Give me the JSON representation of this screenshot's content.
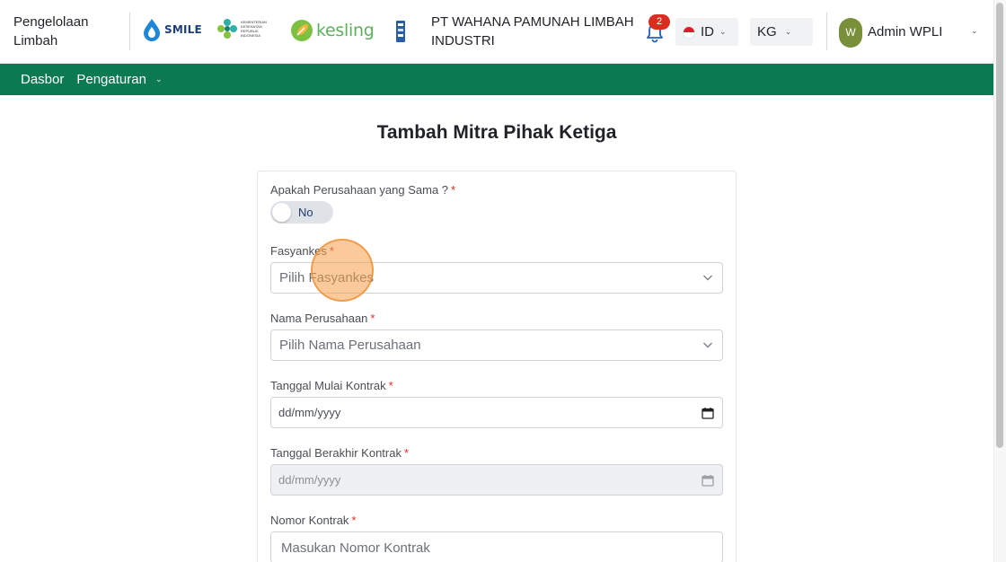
{
  "header": {
    "app_title": "Pengelolaan Limbah",
    "logos": [
      "SMILE",
      "Kementerian Kesehatan Republik Indonesia",
      "kesling"
    ],
    "kemenkes_text": "KEMENTERIAN KESEHATAN REPUBLIK INDONESIA",
    "smile_text": "SMILE",
    "kesling_text": "kesling",
    "company_name": "PT WAHANA PAMUNAH LIMBAH INDUSTRI",
    "notification_count": "2",
    "language": "ID",
    "unit": "KG",
    "avatar_initial": "W",
    "user_name": "Admin WPLI"
  },
  "nav": {
    "items": [
      {
        "label": "Dasbor"
      },
      {
        "label": "Pengaturan"
      }
    ]
  },
  "page": {
    "title": "Tambah Mitra Pihak Ketiga"
  },
  "form": {
    "same_company": {
      "label": "Apakah Perusahaan yang Sama ?",
      "required": "*",
      "value": "No"
    },
    "fasyankes": {
      "label": "Fasyankes",
      "required": "*",
      "placeholder": "Pilih Fasyankes"
    },
    "company_name": {
      "label": "Nama Perusahaan",
      "required": "*",
      "placeholder": "Pilih Nama Perusahaan"
    },
    "start_date": {
      "label": "Tanggal Mulai Kontrak",
      "required": "*",
      "placeholder": "dd/mm/yyyy"
    },
    "end_date": {
      "label": "Tanggal Berakhir Kontrak",
      "required": "*",
      "placeholder": "dd/mm/yyyy"
    },
    "contract_number": {
      "label": "Nomor Kontrak",
      "required": "*",
      "placeholder": "Masukan Nomor Kontrak"
    }
  },
  "colors": {
    "nav_bg": "#0b7a52",
    "badge": "#d92d20",
    "avatar": "#7a8f3a",
    "click_highlight": "#f59e48"
  },
  "icons": [
    "bell-icon",
    "chevron-down-icon",
    "calendar-icon",
    "flag-icon"
  ]
}
